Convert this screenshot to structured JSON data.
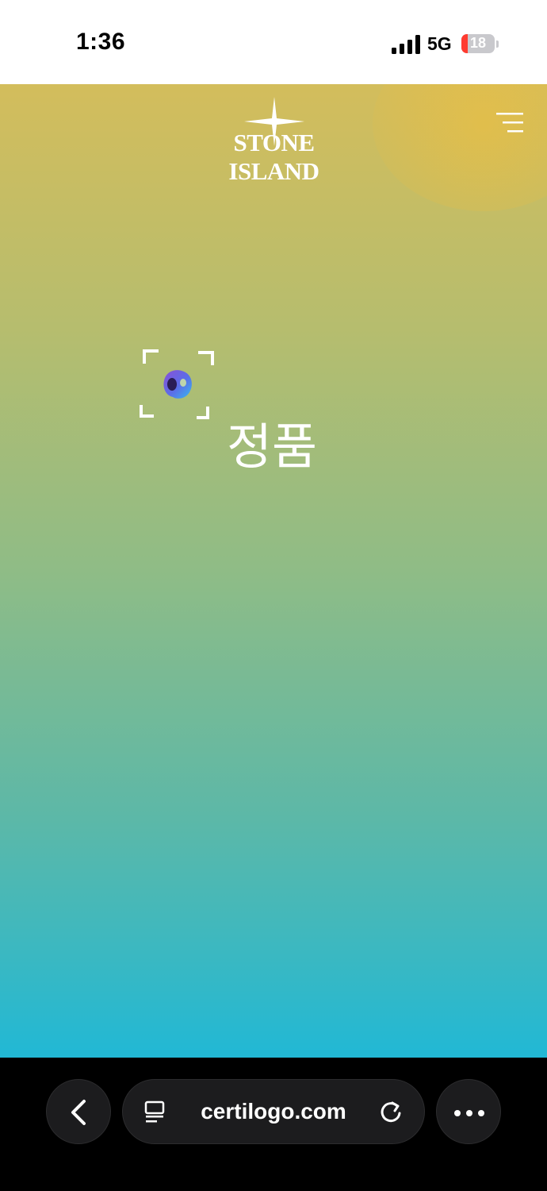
{
  "status_bar": {
    "time": "1:36",
    "network": "5G",
    "battery_level": "18",
    "battery_fraction": 0.18
  },
  "brand": {
    "name": "STONE ISLAND"
  },
  "result": {
    "label": "정품"
  },
  "browser": {
    "url": "certilogo.com"
  },
  "icons": [
    "signal-icon",
    "battery-icon",
    "compass-star-icon",
    "menu-icon",
    "scan-frame-icon",
    "hologram-icon",
    "back-chevron-icon",
    "reader-icon",
    "reload-icon",
    "more-dots-icon"
  ],
  "colors": {
    "gradient_top": "#d3bd5c",
    "gradient_bottom": "#21b8d5",
    "browser_bg": "#000000",
    "battery_low": "#ff3b30"
  }
}
